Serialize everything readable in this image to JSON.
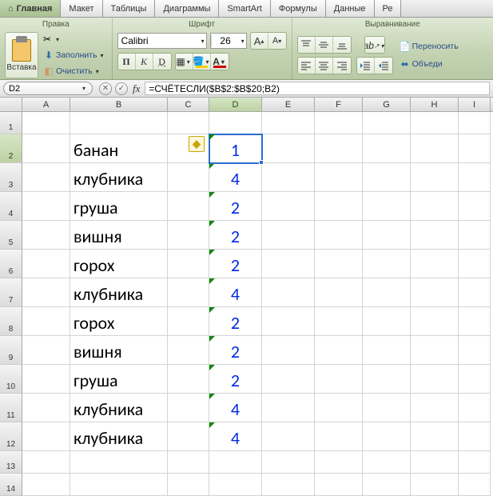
{
  "menu_tabs": [
    {
      "label": "Главная",
      "active": true,
      "has_home_icon": true
    },
    {
      "label": "Макет"
    },
    {
      "label": "Таблицы"
    },
    {
      "label": "Диаграммы"
    },
    {
      "label": "SmartArt"
    },
    {
      "label": "Формулы"
    },
    {
      "label": "Данные"
    },
    {
      "label": "Ре"
    }
  ],
  "ribbon": {
    "edit": {
      "title": "Правка",
      "paste_label": "Вставка",
      "fill_label": "Заполнить",
      "clear_label": "Очистить"
    },
    "font": {
      "title": "Шрифт",
      "name": "Calibri",
      "size": "26"
    },
    "align": {
      "title": "Выравнивание",
      "wrap_label": "Переносить",
      "merge_label": "Объеди"
    }
  },
  "namebox": "D2",
  "formula": "=СЧЁТЕСЛИ($B$2:$B$20;B2)",
  "columns": [
    "A",
    "B",
    "C",
    "D",
    "E",
    "F",
    "G",
    "H",
    "I"
  ],
  "rows": [
    {
      "r": 1,
      "b": "",
      "d": ""
    },
    {
      "r": 2,
      "b": "банан",
      "d": "1",
      "sel": true,
      "err": true
    },
    {
      "r": 3,
      "b": "клубника",
      "d": "4"
    },
    {
      "r": 4,
      "b": "груша",
      "d": "2"
    },
    {
      "r": 5,
      "b": "вишня",
      "d": "2"
    },
    {
      "r": 6,
      "b": "горох",
      "d": "2"
    },
    {
      "r": 7,
      "b": "клубника",
      "d": "4"
    },
    {
      "r": 8,
      "b": "горох",
      "d": "2"
    },
    {
      "r": 9,
      "b": "вишня",
      "d": "2"
    },
    {
      "r": 10,
      "b": "груша",
      "d": "2"
    },
    {
      "r": 11,
      "b": "клубника",
      "d": "4"
    },
    {
      "r": 12,
      "b": "клубника",
      "d": "4"
    },
    {
      "r": 13,
      "b": "",
      "d": ""
    },
    {
      "r": 14,
      "b": "",
      "d": ""
    }
  ]
}
